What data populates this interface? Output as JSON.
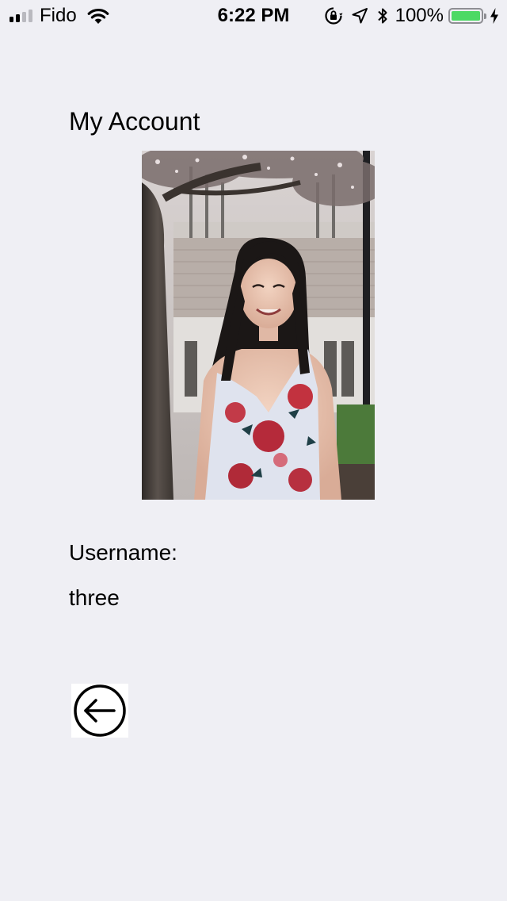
{
  "status_bar": {
    "signal_bars_active": 2,
    "signal_bars_total": 4,
    "carrier": "Fido",
    "time": "6:22 PM",
    "battery_percent": "100%",
    "battery_level": 1.0,
    "battery_color": "#4cd964",
    "icons": [
      "wifi-icon",
      "orientation-lock-icon",
      "location-arrow-icon",
      "bluetooth-icon",
      "battery-icon",
      "charging-bolt-icon"
    ]
  },
  "account": {
    "title": "My Account",
    "profile_photo": "profile-photo",
    "username_label": "Username:",
    "username_value": "three"
  },
  "navigation": {
    "back_icon": "back-arrow-icon"
  },
  "colors": {
    "background": "#efeff4",
    "text": "#000000",
    "back_button_bg": "#ffffff"
  }
}
